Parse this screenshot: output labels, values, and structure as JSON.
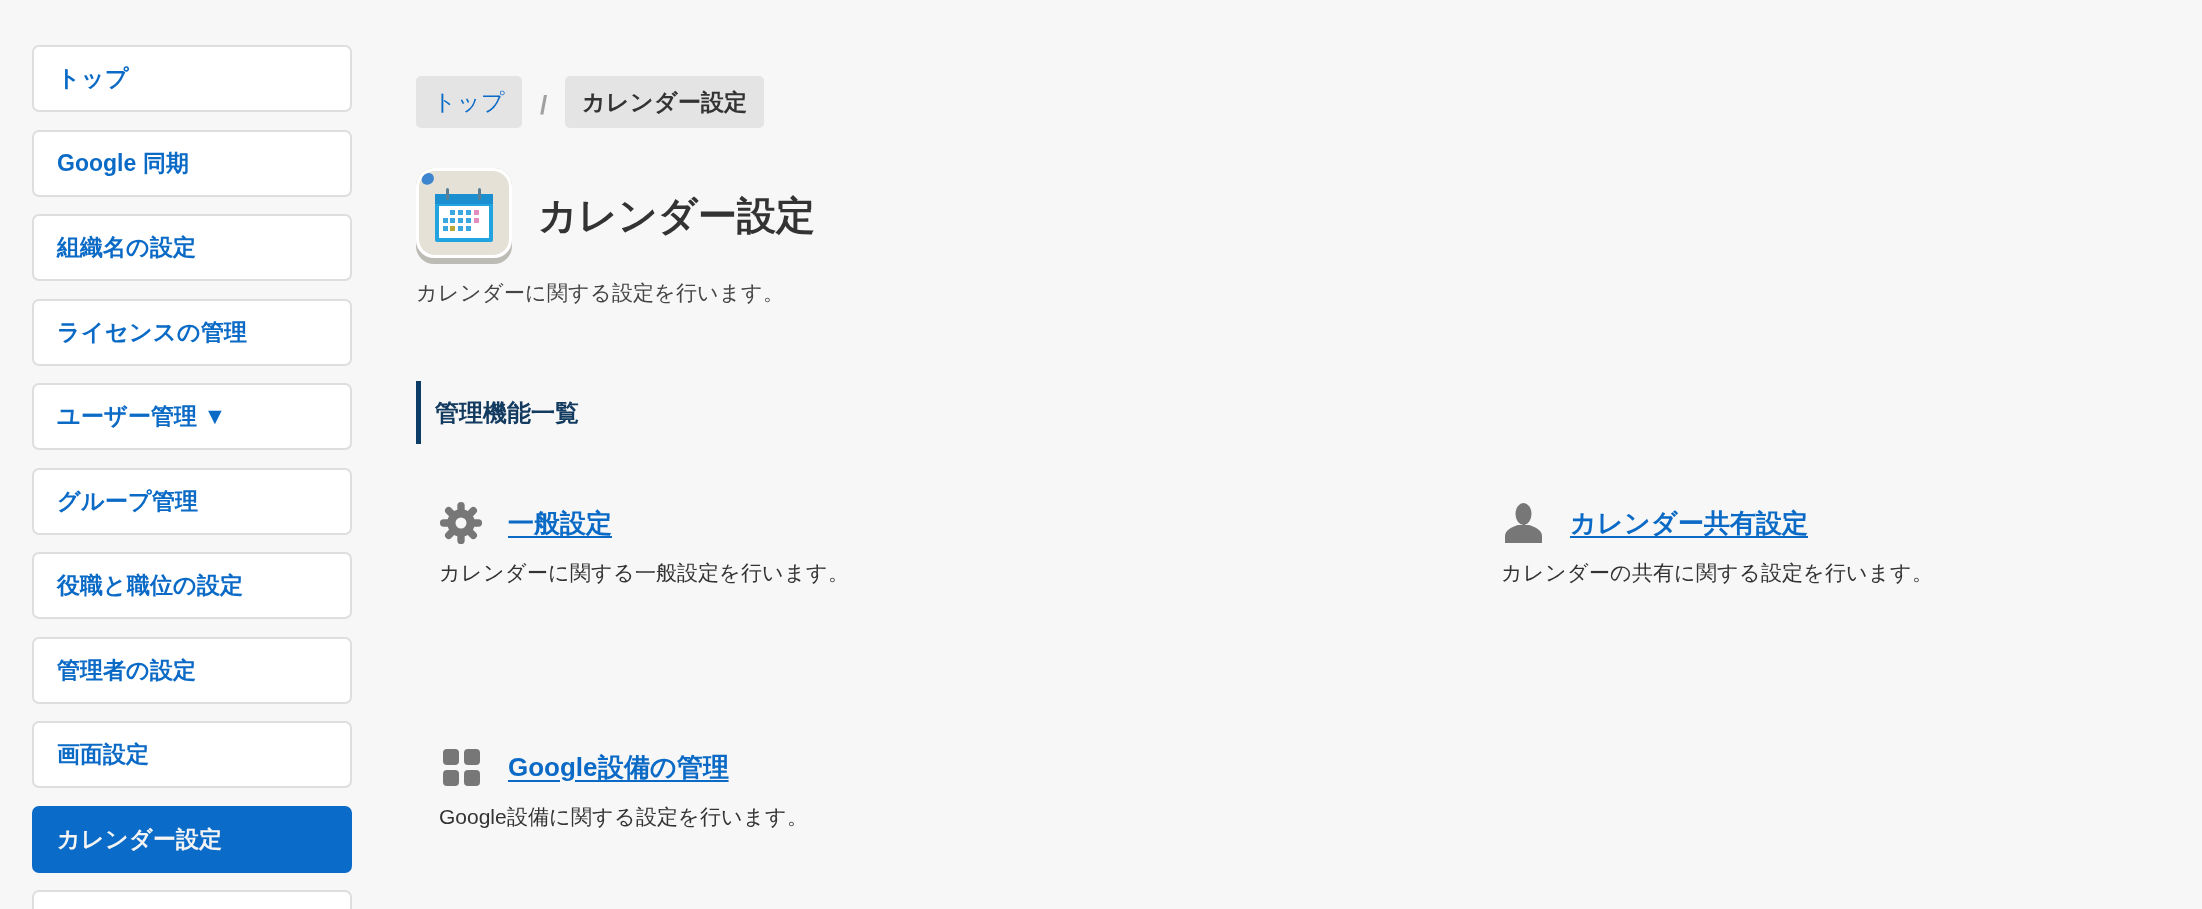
{
  "sidebar": {
    "items": [
      {
        "label": "トップ",
        "selected": false
      },
      {
        "label": "Google 同期",
        "selected": false
      },
      {
        "label": "組織名の設定",
        "selected": false
      },
      {
        "label": "ライセンスの管理",
        "selected": false
      },
      {
        "label": "ユーザー管理 ▼",
        "selected": false
      },
      {
        "label": "グループ管理",
        "selected": false
      },
      {
        "label": "役職と職位の設定",
        "selected": false
      },
      {
        "label": "管理者の設定",
        "selected": false
      },
      {
        "label": "画面設定",
        "selected": false
      },
      {
        "label": "カレンダー設定",
        "selected": true
      }
    ],
    "more_below": true
  },
  "breadcrumb": {
    "items": [
      {
        "label": "トップ",
        "kind": "link"
      },
      {
        "label": "カレンダー設定",
        "kind": "current"
      }
    ],
    "separator": "/"
  },
  "header": {
    "title": "カレンダー設定",
    "description": "カレンダーに関する設定を行います。"
  },
  "section": {
    "heading": "管理機能一覧",
    "items": [
      {
        "kind": "settings",
        "title": "一般設定",
        "description": "カレンダーに関する一般設定を行います。"
      },
      {
        "kind": "sharing",
        "title": "カレンダー共有設定",
        "description": "カレンダーの共有に関する設定を行います。"
      },
      {
        "kind": "resources",
        "title": "Google設備の管理",
        "description": "Google設備に関する設定を行います。"
      }
    ]
  }
}
